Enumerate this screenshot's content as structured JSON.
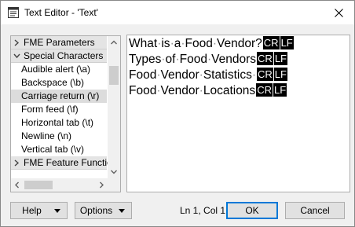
{
  "window": {
    "title": "Text Editor - 'Text'",
    "close_icon": "close-icon",
    "app_icon": "text-editor-icon"
  },
  "tree": {
    "sections": [
      {
        "label": "FME Parameters",
        "expanded": false
      },
      {
        "label": "Special Characters",
        "expanded": true
      },
      {
        "label": "FME Feature Functions",
        "expanded": false
      }
    ],
    "special_characters": [
      {
        "label": "Audible alert (\\a)",
        "selected": false
      },
      {
        "label": "Backspace (\\b)",
        "selected": false
      },
      {
        "label": "Carriage return (\\r)",
        "selected": true
      },
      {
        "label": "Form feed (\\f)",
        "selected": false
      },
      {
        "label": "Horizontal tab (\\t)",
        "selected": false
      },
      {
        "label": "Newline (\\n)",
        "selected": false
      },
      {
        "label": "Vertical tab (\\v)",
        "selected": false
      }
    ]
  },
  "editor": {
    "lines": [
      {
        "words": [
          "What",
          "is",
          "a",
          "Food",
          "Vendor?"
        ],
        "cr": "CR",
        "lf": "LF"
      },
      {
        "words": [
          "Types",
          "of",
          "Food",
          "Vendors"
        ],
        "cr": "CR",
        "lf": "LF"
      },
      {
        "words": [
          "Food",
          "Vendor",
          "Statistics",
          ""
        ],
        "cr": "CR",
        "lf": "LF"
      },
      {
        "words": [
          "Food",
          "Vendor",
          "Locations"
        ],
        "cr": "CR",
        "lf": "LF"
      }
    ],
    "whitespace_marker": "·"
  },
  "footer": {
    "help_label": "Help",
    "options_label": "Options",
    "position": "Ln 1, Col 1",
    "ok_label": "OK",
    "cancel_label": "Cancel"
  },
  "colors": {
    "selection": "#dcdcdc",
    "primary_border": "#0078d7",
    "control_char_bg": "#000000"
  }
}
